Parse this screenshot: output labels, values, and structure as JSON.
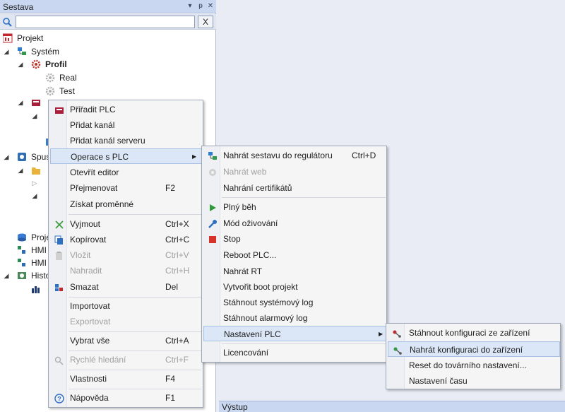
{
  "panel": {
    "title": "Sestava",
    "pin_icon": "pin-icon",
    "dropdown_icon": "chevron-down-icon",
    "close_icon": "close-icon",
    "search_value": "",
    "clear_label": "X"
  },
  "tree": {
    "projekt": "Projekt",
    "system": "Systém",
    "profil": "Profil",
    "real": "Real",
    "test": "Test",
    "spus": "Spus",
    "proje": "Proje",
    "hmi1": "HMI",
    "hmi2": "HMI",
    "histo": "Histo"
  },
  "menu1": {
    "items": [
      {
        "label": "Přiřadit PLC",
        "key": ""
      },
      {
        "label": "Přidat kanál",
        "key": ""
      },
      {
        "label": "Přidat kanál serveru",
        "key": ""
      },
      {
        "label": "Operace s PLC",
        "key": ""
      },
      {
        "label": "Otevřít editor",
        "key": ""
      },
      {
        "label": "Přejmenovat",
        "key": "F2"
      },
      {
        "label": "Získat proměnné",
        "key": ""
      },
      {
        "label": "Vyjmout",
        "key": "Ctrl+X"
      },
      {
        "label": "Kopírovat",
        "key": "Ctrl+C"
      },
      {
        "label": "Vložit",
        "key": "Ctrl+V"
      },
      {
        "label": "Nahradit",
        "key": "Ctrl+H"
      },
      {
        "label": "Smazat",
        "key": "Del"
      },
      {
        "label": "Importovat",
        "key": ""
      },
      {
        "label": "Exportovat",
        "key": ""
      },
      {
        "label": "Vybrat vše",
        "key": "Ctrl+A"
      },
      {
        "label": "Rychlé hledání",
        "key": "Ctrl+F"
      },
      {
        "label": "Vlastnosti",
        "key": "F4"
      },
      {
        "label": "Nápověda",
        "key": "F1"
      }
    ]
  },
  "menu2": {
    "items": [
      {
        "label": "Nahrát sestavu do regulátoru",
        "key": "Ctrl+D"
      },
      {
        "label": "Nahrát web",
        "key": ""
      },
      {
        "label": "Nahrání certifikátů",
        "key": ""
      },
      {
        "label": "Plný běh",
        "key": ""
      },
      {
        "label": "Mód oživování",
        "key": ""
      },
      {
        "label": "Stop",
        "key": ""
      },
      {
        "label": "Reboot PLC...",
        "key": ""
      },
      {
        "label": "Nahrát RT",
        "key": ""
      },
      {
        "label": "Vytvořit boot projekt",
        "key": ""
      },
      {
        "label": "Stáhnout systémový log",
        "key": ""
      },
      {
        "label": "Stáhnout alarmový log",
        "key": ""
      },
      {
        "label": "Nastavení PLC",
        "key": ""
      },
      {
        "label": "Licencování",
        "key": ""
      }
    ]
  },
  "menu3": {
    "items": [
      {
        "label": "Stáhnout konfiguraci ze zařízení"
      },
      {
        "label": "Nahrát konfiguraci do zařízení"
      },
      {
        "label": "Reset do továrního nastavení..."
      },
      {
        "label": "Nastavení času"
      }
    ]
  },
  "output": {
    "label": "Výstup"
  },
  "colors": {
    "panel_header": "#c9d7f0",
    "highlight": "#dbe6f7",
    "menu_bg": "#f5f5f5"
  }
}
